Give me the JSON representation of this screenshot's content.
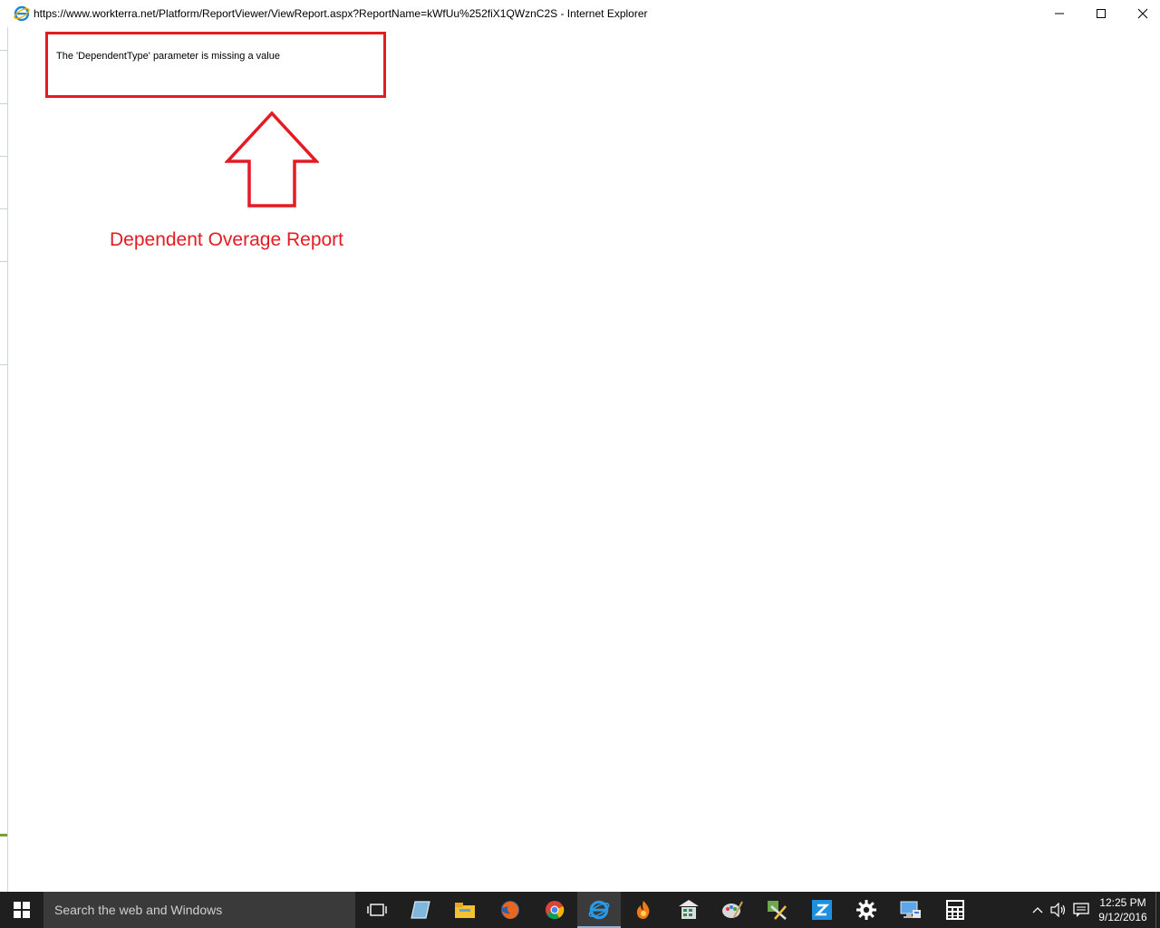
{
  "window": {
    "title": "https://www.workterra.net/Platform/ReportViewer/ViewReport.aspx?ReportName=kWfUu%252fiX1QWznC2S - Internet Explorer"
  },
  "content": {
    "error_message": "The 'DependentType' parameter is missing a value",
    "annotation_label": "Dependent Overage Report",
    "annotation_color": "#e41b23"
  },
  "taskbar": {
    "search_placeholder": "Search the web and Windows",
    "pinned_icons": [
      "task-view-icon",
      "blue-app-icon",
      "file-explorer-icon",
      "firefox-icon",
      "chrome-icon",
      "internet-explorer-icon",
      "flame-app-icon",
      "calculator-sheet-icon",
      "paint-icon",
      "tools-icon",
      "zoom-app-icon",
      "settings-gear-icon",
      "remote-desktop-icon",
      "calculator-icon"
    ],
    "clock_time": "12:25 PM",
    "clock_date": "9/12/2016"
  }
}
